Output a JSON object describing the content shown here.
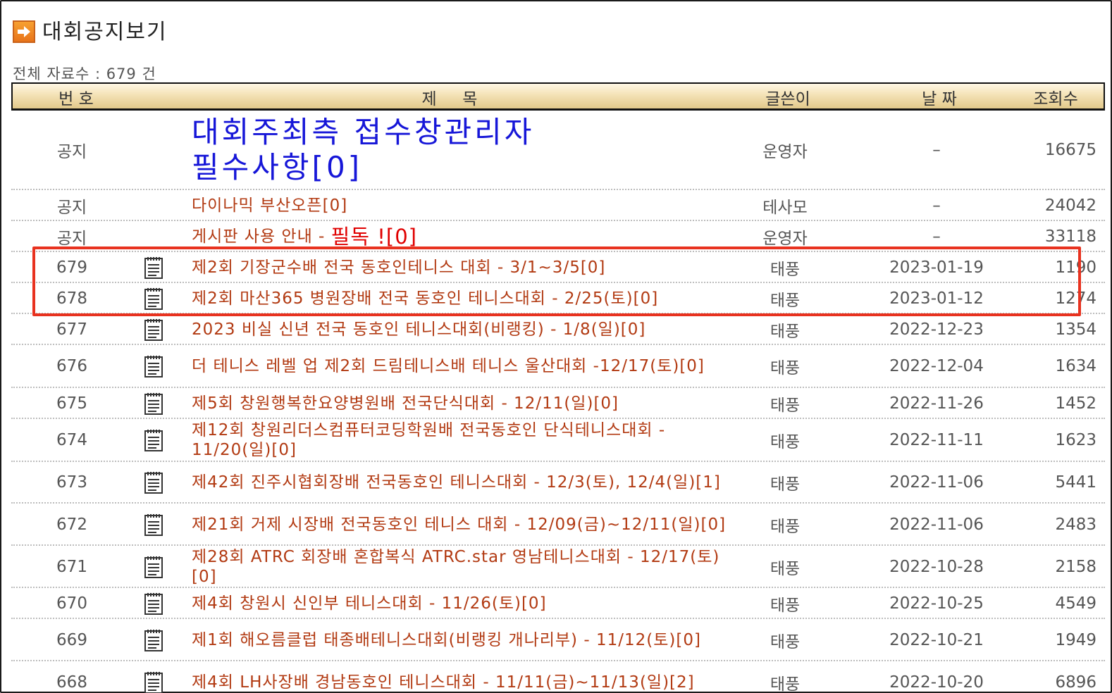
{
  "page": {
    "title": "대회공지보기",
    "total_text": "전체 자료수 : 679 건"
  },
  "columns": {
    "no": "번 호",
    "title": "제     목",
    "writer": "글쓴이",
    "date": "날 짜",
    "views": "조회수"
  },
  "notices": [
    {
      "no": "공지",
      "title_line1": "대회주최측 접수창관리자",
      "title_line2": "필수사항[0]",
      "writer": "운영자",
      "date": "–",
      "views": "16675"
    },
    {
      "no": "공지",
      "title": "다이나믹 부산오픈[0]",
      "writer": "테사모",
      "date": "–",
      "views": "24042"
    },
    {
      "no": "공지",
      "title_pre": "게시판 사용 안내 - ",
      "title_red": "필독 ![0]",
      "writer": "운영자",
      "date": "–",
      "views": "33118"
    }
  ],
  "posts": [
    {
      "no": "679",
      "title": "제2회 기장군수배 전국 동호인테니스 대회 - 3/1~3/5[0]",
      "writer": "태풍",
      "date": "2023-01-19",
      "views": "1190"
    },
    {
      "no": "678",
      "title": "제2회 마산365 병원장배 전국 동호인 테니스대회 - 2/25(토)[0]",
      "writer": "태풍",
      "date": "2023-01-12",
      "views": "1274"
    },
    {
      "no": "677",
      "title": "2023 비실 신년 전국 동호인 테니스대회(비랭킹) - 1/8(일)[0]",
      "writer": "태풍",
      "date": "2022-12-23",
      "views": "1354"
    },
    {
      "no": "676",
      "title": "더 테니스 레벨 업 제2회 드림테니스배 테니스 울산대회 -12/17(토)[0]",
      "writer": "태풍",
      "date": "2022-12-04",
      "views": "1634"
    },
    {
      "no": "675",
      "title": "제5회 창원행복한요양병원배 전국단식대회 - 12/11(일)[0]",
      "writer": "태풍",
      "date": "2022-11-26",
      "views": "1452"
    },
    {
      "no": "674",
      "title": "제12회 창원리더스컴퓨터코딩학원배 전국동호인 단식테니스대회 - 11/20(일)[0]",
      "writer": "태풍",
      "date": "2022-11-11",
      "views": "1623"
    },
    {
      "no": "673",
      "title": "제42회 진주시협회장배 전국동호인 테니스대회 - 12/3(토), 12/4(일)[1]",
      "writer": "태풍",
      "date": "2022-11-06",
      "views": "5441"
    },
    {
      "no": "672",
      "title": "제21회 거제 시장배 전국동호인 테니스 대회 - 12/09(금)~12/11(일)[0]",
      "writer": "태풍",
      "date": "2022-11-06",
      "views": "2483"
    },
    {
      "no": "671",
      "title": "제28회 ATRC 회장배 혼합복식 ATRC.star 영남테니스대회 - 12/17(토)[0]",
      "writer": "태풍",
      "date": "2022-10-28",
      "views": "2158"
    },
    {
      "no": "670",
      "title": "제4회 창원시 신인부 테니스대회 - 11/26(토)[0]",
      "writer": "태풍",
      "date": "2022-10-25",
      "views": "4549"
    },
    {
      "no": "669",
      "title": "제1회 해오름클럽 태종배테니스대회(비랭킹 개나리부) - 11/12(토)[0]",
      "writer": "태풍",
      "date": "2022-10-21",
      "views": "1949"
    },
    {
      "no": "668",
      "title": "제4회 LH사장배 경남동호인 테니스대회 - 11/11(금)~11/13(일)[2]",
      "writer": "태풍",
      "date": "2022-10-20",
      "views": "6896"
    }
  ],
  "icons": {
    "header": "arrow-right-icon",
    "post": "document-icon"
  },
  "colors": {
    "title_link": "#b23a12",
    "notice_blue": "#1616d8",
    "notice_red": "#e00000",
    "highlight": "#e8321f"
  }
}
